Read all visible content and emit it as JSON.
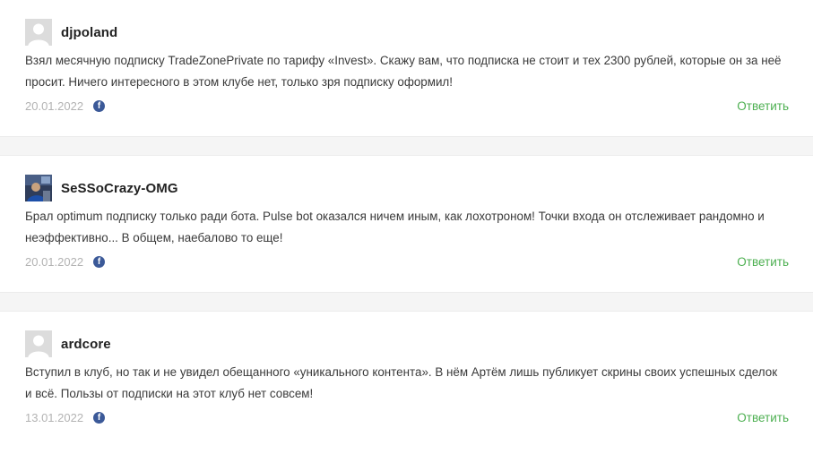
{
  "comments": [
    {
      "author": "djpoland",
      "avatar": "default-avatar",
      "text": "Взял месячную подписку TradeZonePrivate по тарифу «Invest». Скажу вам, что подписка не стоит и тех 2300 рублей, которые он за неё просит. Ничего интересного в этом клубе нет, только зря подписку оформил!",
      "date": "20.01.2022",
      "icon": "facebook-icon",
      "reply_label": "Ответить"
    },
    {
      "author": "SeSSoCrazy-OMG",
      "avatar": "photo-avatar",
      "text": "Брал optimum подписку только ради бота. Pulse bot оказался ничем иным, как лохотроном! Точки входа он отслеживает рандомно и неэффективно... В общем, наебалово то еще!",
      "date": "20.01.2022",
      "icon": "facebook-icon",
      "reply_label": "Ответить"
    },
    {
      "author": "ardcore",
      "avatar": "default-avatar",
      "text": "Вступил в клуб, но так и не увидел обещанного «уникального контента». В нём Артём лишь публикует скрины своих успешных сделок и всё. Пользы от подписки на этот клуб нет совсем!",
      "date": "13.01.2022",
      "icon": "facebook-icon",
      "reply_label": "Ответить"
    }
  ],
  "colors": {
    "reply": "#4caf50",
    "date": "#b3b3b3",
    "facebook": "#3b5998",
    "separator": "#f5f5f5"
  }
}
